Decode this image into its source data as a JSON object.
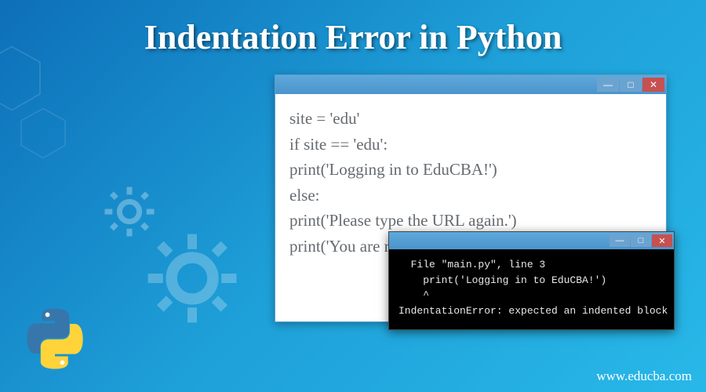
{
  "title": "Indentation Error in Python",
  "editor": {
    "lines": [
      "site = 'edu'",
      "if site == 'edu':",
      "print('Logging in to EduCBA!')",
      "else:",
      "print('Please type the URL again.')",
      "print('You are ready to go!')"
    ]
  },
  "terminal": {
    "lines": [
      "  File \"main.py\", line 3",
      "    print('Logging in to EduCBA!')",
      "    ^",
      "IndentationError: expected an indented block"
    ]
  },
  "footer": {
    "url": "www.educba.com"
  },
  "window_controls": {
    "minimize": "—",
    "maximize": "□",
    "close": "✕"
  }
}
